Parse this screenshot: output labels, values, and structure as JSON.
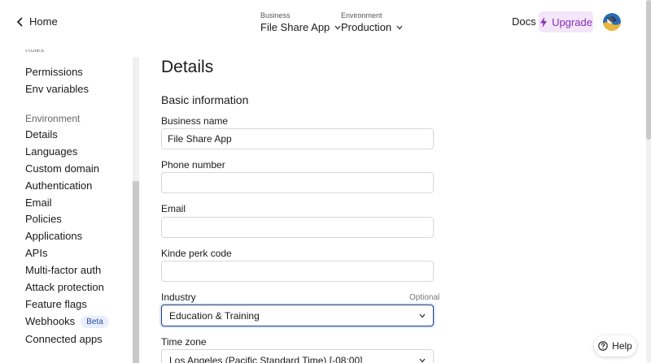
{
  "topbar": {
    "home_label": "Home",
    "business": {
      "caption": "Business",
      "value": "File Share App"
    },
    "environment": {
      "caption": "Environment",
      "value": "Production"
    },
    "docs_label": "Docs",
    "upgrade_label": "Upgrade"
  },
  "sidebar": {
    "partial_label": "Roles",
    "items_top": [
      {
        "label": "Permissions"
      },
      {
        "label": "Env variables"
      }
    ],
    "environment_heading": "Environment",
    "items_env": [
      {
        "label": "Details"
      },
      {
        "label": "Languages"
      },
      {
        "label": "Custom domain"
      },
      {
        "label": "Authentication"
      },
      {
        "label": "Email"
      },
      {
        "label": "Policies"
      },
      {
        "label": "Applications"
      },
      {
        "label": "APIs"
      },
      {
        "label": "Multi-factor auth"
      },
      {
        "label": "Attack protection"
      },
      {
        "label": "Feature flags"
      },
      {
        "label": "Webhooks",
        "badge": "Beta"
      },
      {
        "label": "Connected apps"
      }
    ]
  },
  "main": {
    "title": "Details",
    "section": "Basic information",
    "fields": {
      "business_name": {
        "label": "Business name",
        "value": "File Share App"
      },
      "phone": {
        "label": "Phone number",
        "value": ""
      },
      "email": {
        "label": "Email",
        "value": ""
      },
      "perk": {
        "label": "Kinde perk code",
        "value": ""
      },
      "industry": {
        "label": "Industry",
        "optional": "Optional",
        "value": "Education & Training"
      },
      "timezone": {
        "label": "Time zone",
        "value": "Los Angeles (Pacific Standard Time) [-08:00]"
      }
    }
  },
  "help_label": "Help",
  "colors": {
    "upgrade_bg": "#f3e6f9",
    "upgrade_text": "#8a2fb8",
    "focus_border": "#1f3f78",
    "beta_bg": "#e9eefc"
  }
}
